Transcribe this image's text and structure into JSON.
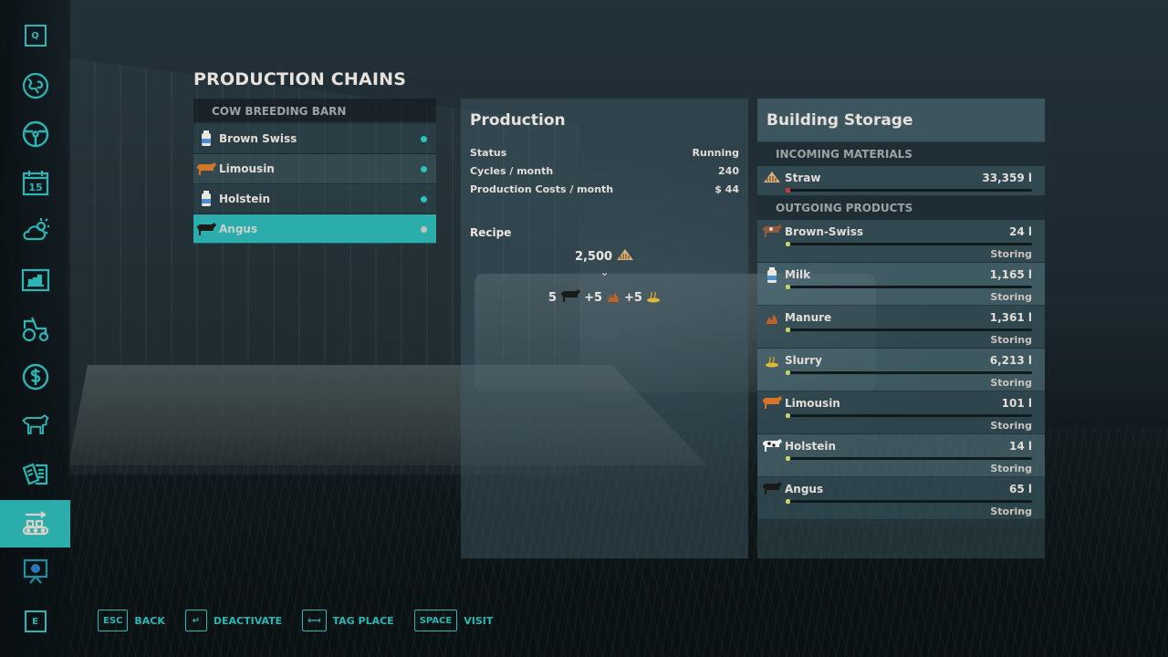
{
  "sidebar": {
    "top_key": "Q",
    "bottom_key": "E",
    "items": [
      {
        "name": "map",
        "icon": "globe-map-icon"
      },
      {
        "name": "vehicles",
        "icon": "steering-wheel-icon"
      },
      {
        "name": "calendar",
        "icon": "calendar-icon",
        "label": "15"
      },
      {
        "name": "weather",
        "icon": "weather-icon"
      },
      {
        "name": "prices",
        "icon": "bar-chart-icon"
      },
      {
        "name": "garage",
        "icon": "tractor-icon"
      },
      {
        "name": "finances",
        "icon": "dollar-icon"
      },
      {
        "name": "animals",
        "icon": "cow-icon"
      },
      {
        "name": "contracts",
        "icon": "documents-icon"
      },
      {
        "name": "production",
        "icon": "conveyor-icon",
        "active": true
      },
      {
        "name": "tutorial",
        "icon": "presentation-icon"
      }
    ]
  },
  "page_title": "PRODUCTION CHAINS",
  "chains": {
    "header": "COW BREEDING BARN",
    "items": [
      {
        "label": "Brown Swiss",
        "icon": "milk-can-icon",
        "status_color": "#2bc2c0"
      },
      {
        "label": "Limousin",
        "icon": "limousin-cow-icon",
        "status_color": "#2bc2c0"
      },
      {
        "label": "Holstein",
        "icon": "milk-can-icon",
        "status_color": "#2bc2c0"
      },
      {
        "label": "Angus",
        "icon": "angus-cow-icon",
        "status_color": "#c9c0bd",
        "selected": true
      }
    ]
  },
  "production": {
    "title": "Production",
    "rows": [
      {
        "label": "Status",
        "value": "Running"
      },
      {
        "label": "Cycles / month",
        "value": "240"
      },
      {
        "label": "Production Costs / month",
        "value": "$ 44"
      }
    ],
    "recipe_title": "Recipe",
    "recipe_input": {
      "amount": "2,500",
      "icon": "straw-icon"
    },
    "recipe_outputs": [
      {
        "prefix": "5",
        "icon": "angus-cow-icon"
      },
      {
        "prefix": "+5",
        "icon": "manure-icon"
      },
      {
        "prefix": "+5",
        "icon": "slurry-icon"
      }
    ]
  },
  "storage": {
    "title": "Building Storage",
    "incoming_label": "INCOMING MATERIALS",
    "incoming": [
      {
        "name": "Straw",
        "amount": "33,359 l",
        "icon": "straw-icon",
        "fill": 0.01,
        "fill_color": "#d23a3a"
      }
    ],
    "outgoing_label": "OUTGOING PRODUCTS",
    "outgoing": [
      {
        "name": "Brown-Swiss",
        "amount": "24 l",
        "state": "Storing",
        "icon": "brown-swiss-cow-icon",
        "fill": 0.01,
        "fill_color": "#c7d36a"
      },
      {
        "name": "Milk",
        "amount": "1,165 l",
        "state": "Storing",
        "icon": "milk-can-icon",
        "fill": 0.01,
        "fill_color": "#c7d36a"
      },
      {
        "name": "Manure",
        "amount": "1,361 l",
        "state": "Storing",
        "icon": "manure-icon",
        "fill": 0.01,
        "fill_color": "#c7d36a"
      },
      {
        "name": "Slurry",
        "amount": "6,213 l",
        "state": "Storing",
        "icon": "slurry-icon",
        "fill": 0.01,
        "fill_color": "#c7d36a"
      },
      {
        "name": "Limousin",
        "amount": "101 l",
        "state": "Storing",
        "icon": "limousin-cow-icon",
        "fill": 0.01,
        "fill_color": "#c7d36a"
      },
      {
        "name": "Holstein",
        "amount": "14 l",
        "state": "Storing",
        "icon": "holstein-cow-icon",
        "fill": 0.01,
        "fill_color": "#c7d36a"
      },
      {
        "name": "Angus",
        "amount": "65 l",
        "state": "Storing",
        "icon": "angus-cow-icon",
        "fill": 0.01,
        "fill_color": "#c7d36a"
      }
    ]
  },
  "footer": [
    {
      "key": "ESC",
      "label": "BACK"
    },
    {
      "key": "↵",
      "label": "DEACTIVATE"
    },
    {
      "key": "⟻",
      "label": "TAG PLACE"
    },
    {
      "key": "SPACE",
      "label": "VISIT"
    }
  ],
  "colors": {
    "accent": "#2aadab"
  }
}
